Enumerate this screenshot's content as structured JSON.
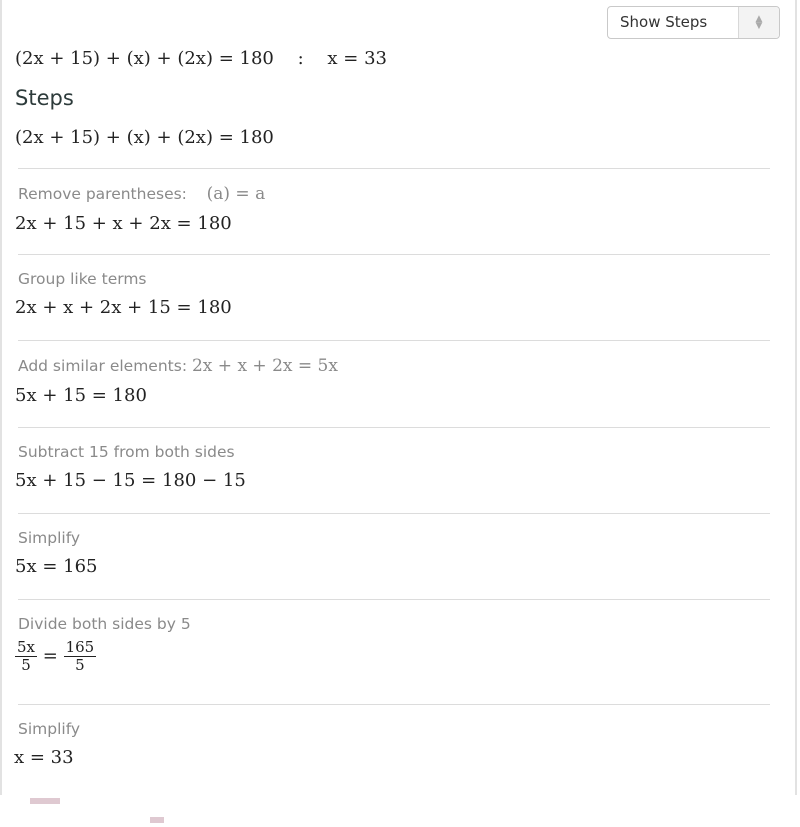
{
  "toolbar": {
    "show_steps_select": {
      "selected": "Show Steps",
      "icon": "up-down-chevron-icon"
    }
  },
  "result": {
    "equation": "(2x + 15) + (x) + (2x) = 180",
    "separator": ":",
    "solution": "x = 33"
  },
  "steps": {
    "title": "Steps",
    "initial_equation": "(2x + 15) + (x) + (2x) = 180",
    "items": [
      {
        "description": "Remove parentheses:",
        "rule": "(a) = a",
        "result": "2x + 15 + x + 2x = 180"
      },
      {
        "description": "Group like terms",
        "rule": "",
        "result": "2x + x + 2x + 15 = 180"
      },
      {
        "description": "Add similar elements:",
        "rule": "2x + x + 2x = 5x",
        "result": "5x + 15 = 180"
      },
      {
        "description": "Subtract 15 from both sides",
        "rule": "",
        "result": "5x + 15 − 15 = 180 − 15"
      },
      {
        "description": "Simplify",
        "rule": "",
        "result": "5x = 165"
      },
      {
        "description": "Divide both sides by 5",
        "rule": "",
        "result": "5x/5 = 165/5",
        "result_parts": {
          "lhs_num": "5x",
          "lhs_den": "5",
          "eq": "=",
          "rhs_num": "165",
          "rhs_den": "5"
        }
      },
      {
        "description": "Simplify",
        "rule": "",
        "result": "x = 33"
      }
    ]
  }
}
